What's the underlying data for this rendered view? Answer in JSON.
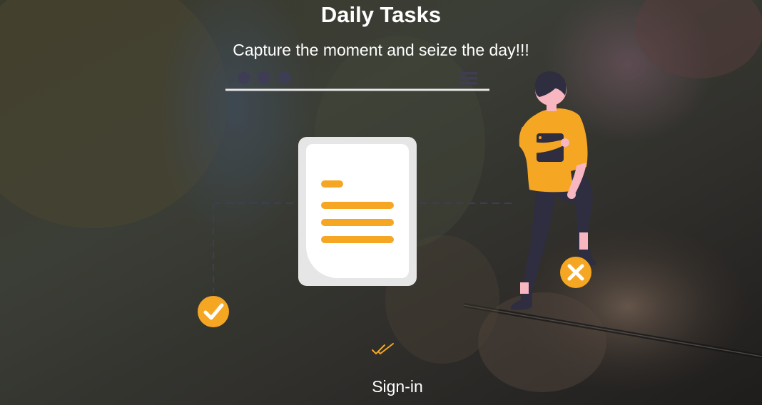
{
  "header": {
    "title": "Daily Tasks",
    "subtitle": "Capture the moment and seize the day!!!"
  },
  "action": {
    "signin_label": "Sign-in"
  },
  "icons": {
    "confirm": "checkmark-circle-icon",
    "dismiss": "x-circle-icon",
    "decor": "double-check-icon"
  },
  "colors": {
    "accent": "#f5a623",
    "figure_dark": "#2f2e41",
    "skin": "#f7b6c0",
    "document_bg": "#e6e6e6",
    "document_page": "#ffffff",
    "text": "#ffffff"
  }
}
